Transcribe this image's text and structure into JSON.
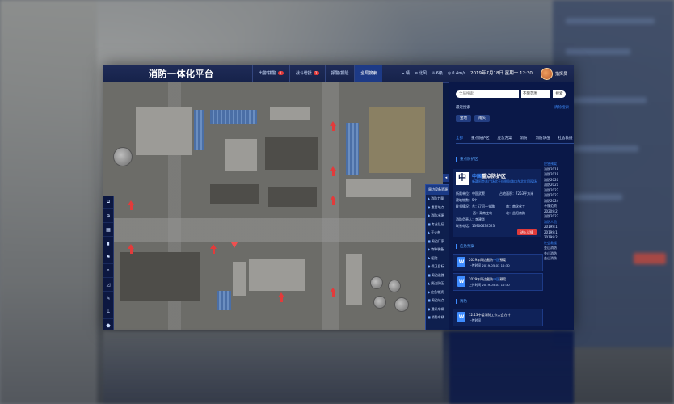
{
  "app": {
    "title": "消防一体化平台"
  },
  "topnav": [
    {
      "label": "出警/拨警",
      "badge": "1"
    },
    {
      "label": "战斗增援",
      "badge": "2"
    },
    {
      "label": "报警/报险",
      "badge": ""
    },
    {
      "label": "全局搜索",
      "badge": "",
      "active": true
    }
  ],
  "weather": [
    {
      "icon": "cloud-icon",
      "glyph": "☁",
      "text": "晴"
    },
    {
      "icon": "wind-icon",
      "glyph": "≋",
      "text": "北风"
    },
    {
      "icon": "sun-icon",
      "glyph": "☼",
      "text": "6级"
    },
    {
      "icon": "speed-icon",
      "glyph": "◎",
      "text": "0.4m/s"
    }
  ],
  "datetime": "2019年7月18日 星期一 12:30",
  "user": {
    "name": "指挥员"
  },
  "search": {
    "placeholder": "全局搜索",
    "select": "不限范围",
    "button": "搜索",
    "recent_label": "最近搜索",
    "clear_label": "清除搜索",
    "recent_tags": [
      "金地",
      "南头"
    ]
  },
  "categories": [
    "全部",
    "重点防护区",
    "应急方案",
    "消防",
    "消防队伍",
    "社会救援"
  ],
  "detail": {
    "section_title": "重点防护区",
    "char": "中",
    "title_hl": "中国",
    "title_rest": "重点防护区",
    "address": "新疆阿克苏广场北干线侧向路口东北大团现场",
    "rows": [
      {
        "k": "所属单位：",
        "v": "中国武警"
      },
      {
        "k": "占地面积：",
        "v": "7253平方米"
      },
      {
        "k": "建筑物数：",
        "v": "5个"
      },
      {
        "k": "毗邻情况：",
        "v": "东：辽河一支路"
      },
      {
        "k": "",
        "v": "南：南化化工"
      },
      {
        "k": "",
        "v": "西：青南变电"
      },
      {
        "k": "",
        "v": "北：益阳南路"
      },
      {
        "k": "消防负责人：",
        "v": "李建华"
      },
      {
        "k": "联系电话：",
        "v": "13906632523"
      }
    ],
    "enter_button": "进入详情"
  },
  "docs_title": "应急预案",
  "docs": [
    {
      "name_a": "2029年四边截防",
      "name_hl": "中国",
      "name_b": "预案",
      "time": "上传时间 2019-05-03 12:30"
    },
    {
      "name_a": "2029年四边截防",
      "name_hl": "中国",
      "name_b": "预案",
      "time": "上传时间 2019-05-03 12:30"
    }
  ],
  "more_title": "消防",
  "more_doc": {
    "name": "12.13中楼消防工作大会方针",
    "time": "上传时间"
  },
  "side_list": [
    {
      "text": "应急预案",
      "hl": true
    },
    {
      "text": "消防2018",
      "hl": false
    },
    {
      "text": "消防2019",
      "hl": false
    },
    {
      "text": "消防2020",
      "hl": false
    },
    {
      "text": "消防2021",
      "hl": false
    },
    {
      "text": "消防2022",
      "hl": false
    },
    {
      "text": "消防2023",
      "hl": false
    },
    {
      "text": "消防2024",
      "hl": false
    },
    {
      "text": "不规范资",
      "hl": false
    },
    {
      "text": "2020年2",
      "hl": false
    },
    {
      "text": "消防2023",
      "hl": false
    },
    {
      "text": "消防人员",
      "hl": true
    },
    {
      "text": "2019年1",
      "hl": false
    },
    {
      "text": "2019年1",
      "hl": false
    },
    {
      "text": "2019年2",
      "hl": false
    },
    {
      "text": "社会救援",
      "hl": true
    },
    {
      "text": "金山消防",
      "hl": false
    },
    {
      "text": "金山消防",
      "hl": false
    },
    {
      "text": "金山消防",
      "hl": false
    }
  ],
  "layer_panel": {
    "head": "周边设备资源",
    "items": [
      {
        "icon": "hydrant-icon",
        "glyph": "▲",
        "text": "消防力量"
      },
      {
        "icon": "poi-icon",
        "glyph": "●",
        "text": "重要地点"
      },
      {
        "icon": "water-icon",
        "glyph": "◆",
        "text": "消防水源"
      },
      {
        "icon": "unit-icon",
        "glyph": "■",
        "text": "专业队伍"
      },
      {
        "icon": "fire-icon",
        "glyph": "▲",
        "text": "灭火剂"
      },
      {
        "icon": "factory-icon",
        "glyph": "■",
        "text": "周边厂家"
      },
      {
        "icon": "special-icon",
        "glyph": "◆",
        "text": "特种装备"
      },
      {
        "icon": "hospital-icon",
        "glyph": "✚",
        "text": "医院"
      },
      {
        "icon": "guard-icon",
        "glyph": "●",
        "text": "保卫目标"
      },
      {
        "icon": "road-icon",
        "glyph": "■",
        "text": "周边道路"
      },
      {
        "icon": "team-icon",
        "glyph": "▲",
        "text": "周边队伍"
      },
      {
        "icon": "relief-icon",
        "glyph": "◆",
        "text": "应急物资"
      },
      {
        "icon": "station-icon",
        "glyph": "■",
        "text": "周边站点"
      },
      {
        "icon": "power-icon",
        "glyph": "●",
        "text": "通讯车辆"
      },
      {
        "icon": "vehicle-icon",
        "glyph": "■",
        "text": "消防车辆"
      }
    ]
  },
  "tools": [
    {
      "name": "layer-tool-icon",
      "glyph": "⧉"
    },
    {
      "name": "locate-tool-icon",
      "glyph": "⊕"
    },
    {
      "name": "grid-tool-icon",
      "glyph": "▦"
    },
    {
      "name": "ruler-tool-icon",
      "glyph": "▮"
    },
    {
      "name": "mark-tool-icon",
      "glyph": "⚑"
    },
    {
      "name": "zoom-tool-icon",
      "glyph": "⌕"
    },
    {
      "name": "area-tool-icon",
      "glyph": "◿"
    },
    {
      "name": "pen-tool-icon",
      "glyph": "✎"
    },
    {
      "name": "measure-tool-icon",
      "glyph": "⟂"
    },
    {
      "name": "draw-tool-icon",
      "glyph": "⬟"
    },
    {
      "name": "pin-tool-icon",
      "glyph": "⌖"
    }
  ],
  "colors": {
    "accent": "#3e8cff",
    "danger": "#e03a3a",
    "panel": "#0a1848"
  }
}
